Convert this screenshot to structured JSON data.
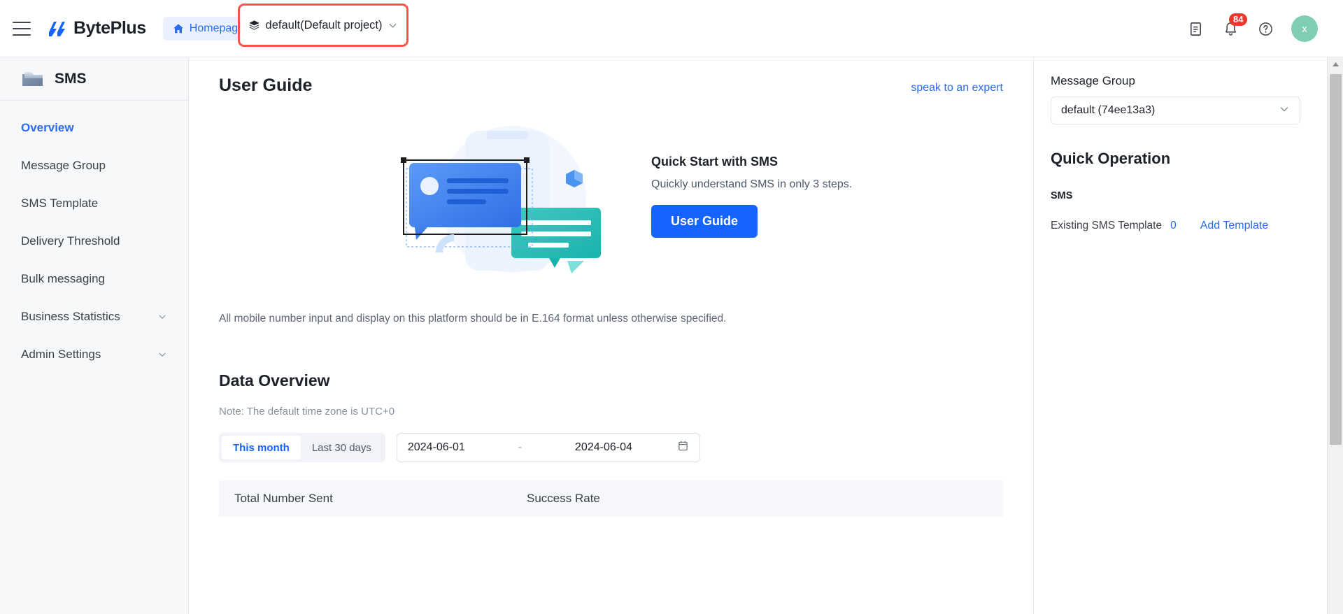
{
  "header": {
    "menu_icon": "hamburger-menu-icon",
    "brand": "BytePlus",
    "homepage_label": "Homepage",
    "home_icon": "home-icon",
    "project_selector": {
      "label": "default(Default project)",
      "stack_icon": "layers-icon",
      "chevron": "chevron-down-icon",
      "highlight_color": "#f8544a"
    },
    "doc_icon": "document-icon",
    "bell_icon": "bell-icon",
    "notification_count": "84",
    "help_icon": "question-circle-icon",
    "avatar_initial": "x",
    "avatar_color": "#7ecdb4"
  },
  "sidebar": {
    "product": "SMS",
    "product_icon": "folder-icon",
    "items": [
      {
        "label": "Overview",
        "active": true,
        "expandable": false
      },
      {
        "label": "Message Group",
        "active": false,
        "expandable": false
      },
      {
        "label": "SMS Template",
        "active": false,
        "expandable": false
      },
      {
        "label": "Delivery Threshold",
        "active": false,
        "expandable": false
      },
      {
        "label": "Bulk messaging",
        "active": false,
        "expandable": false
      },
      {
        "label": "Business Statistics",
        "active": false,
        "expandable": true
      },
      {
        "label": "Admin Settings",
        "active": false,
        "expandable": true
      }
    ]
  },
  "main": {
    "page_title": "User Guide",
    "expert_link": "speak to an expert",
    "hero": {
      "heading": "Quick Start with SMS",
      "subtext": "Quickly understand SMS in only 3 steps.",
      "button_label": "User Guide",
      "illustration": "sms-bubbles-illustration"
    },
    "note": "All mobile number input and display on this platform should be in E.164 format unless otherwise specified.",
    "data_overview": {
      "title": "Data Overview",
      "timezone_note": "Note: The default time zone is UTC+0",
      "range_presets": [
        {
          "label": "This month",
          "selected": true
        },
        {
          "label": "Last 30 days",
          "selected": false
        }
      ],
      "date_start": "2024-06-01",
      "date_separator": "-",
      "date_end": "2024-06-04",
      "calendar_icon": "calendar-icon",
      "stat_columns": [
        "Total Number Sent",
        "Success Rate"
      ]
    }
  },
  "right_panel": {
    "message_group_label": "Message Group",
    "message_group_value": "default (74ee13a3)",
    "chevron": "chevron-down-icon",
    "quick_operation_title": "Quick Operation",
    "sms_subtitle": "SMS",
    "existing_template_label": "Existing SMS Template",
    "existing_template_count": "0",
    "add_template_label": "Add Template"
  },
  "scrollbar": {
    "up_arrow": "triangle-up-icon"
  },
  "colors": {
    "accent_blue": "#1664ff",
    "link_blue": "#2a6bf2",
    "highlight_red": "#f8544a",
    "badge_red": "#e8392f",
    "avatar_green": "#7ecdb4"
  }
}
